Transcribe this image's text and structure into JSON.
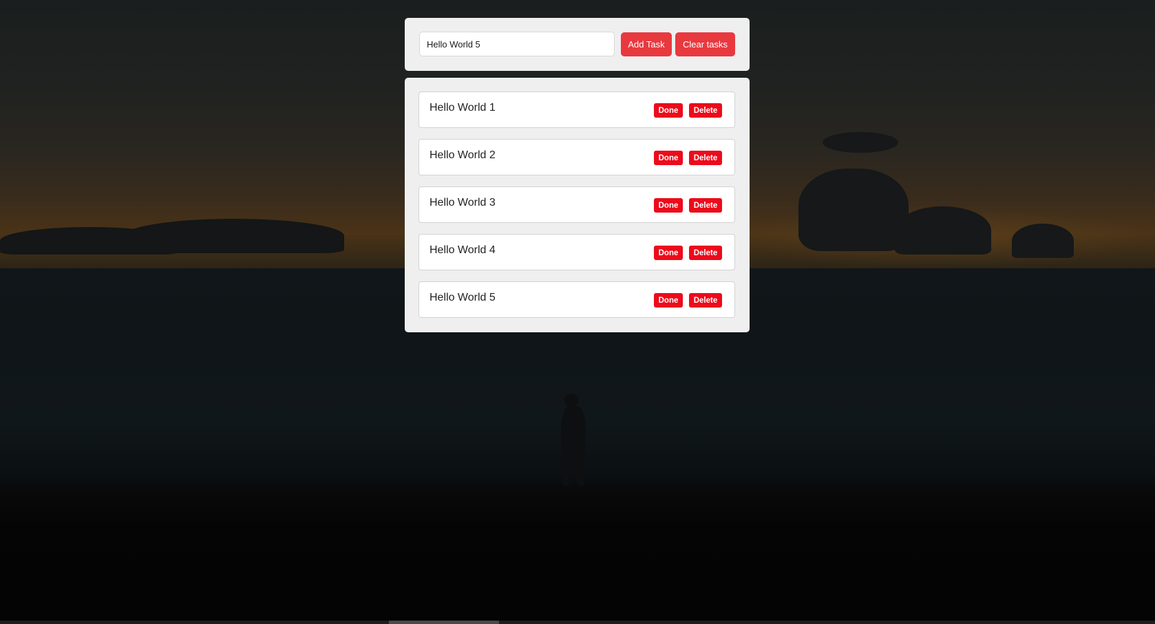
{
  "task_form": {
    "input_value": "Hello World 5",
    "add_label": "Add Task",
    "clear_label": "Clear tasks"
  },
  "tasks": [
    {
      "text": "Hello World 1",
      "done_label": "Done",
      "delete_label": "Delete"
    },
    {
      "text": "Hello World 2",
      "done_label": "Done",
      "delete_label": "Delete"
    },
    {
      "text": "Hello World 3",
      "done_label": "Done",
      "delete_label": "Delete"
    },
    {
      "text": "Hello World 4",
      "done_label": "Done",
      "delete_label": "Delete"
    },
    {
      "text": "Hello World 5",
      "done_label": "Done",
      "delete_label": "Delete"
    }
  ],
  "colors": {
    "accent": "#e8393f",
    "item_button": "#ec0b1b",
    "panel": "#efefef"
  }
}
